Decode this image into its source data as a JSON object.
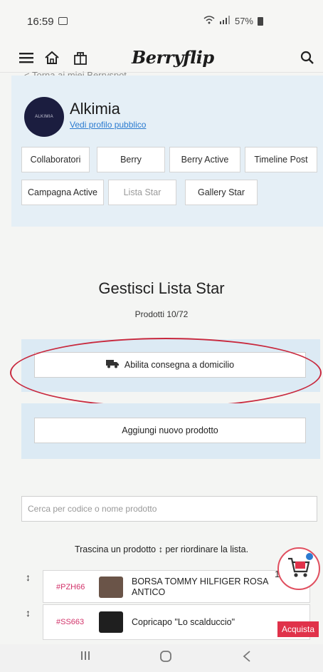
{
  "status_bar": {
    "time": "16:59",
    "battery": "57%"
  },
  "header": {
    "brand": "Berryflip"
  },
  "back_link": "< Torna ai miei Berryspot",
  "profile": {
    "name": "Alkimia",
    "link": "Vedi profilo pubblico",
    "avatar_text": "ALKIMIA"
  },
  "tabs": [
    "Collaboratori",
    "Berry",
    "Berry Active",
    "Timeline Post",
    "Campagna Active",
    "Lista Star",
    "Gallery Star"
  ],
  "main": {
    "title": "Gestisci Lista Star",
    "product_count": "Prodotti 10/72",
    "delivery_button": "Abilita consegna a domicilio",
    "add_button": "Aggiungi nuovo prodotto",
    "search_placeholder": "Cerca per codice o nome prodotto",
    "hint": "Trascina un prodotto  ↕  per riordinare la lista."
  },
  "products": [
    {
      "code": "#PZH66",
      "name": "BORSA TOMMY HILFIGER ROSA ANTICO"
    },
    {
      "code": "#SS663",
      "name": "Copricapo \"Lo scalduccio\""
    }
  ],
  "acquista": "Acquista",
  "trail_digit": "1",
  "colors": {
    "accent_link": "#2b7bd0",
    "code_pink": "#d2336a",
    "acquista_red": "#e0324a",
    "panel_blue": "#dceaf4",
    "annotation_red": "#c8283d"
  }
}
